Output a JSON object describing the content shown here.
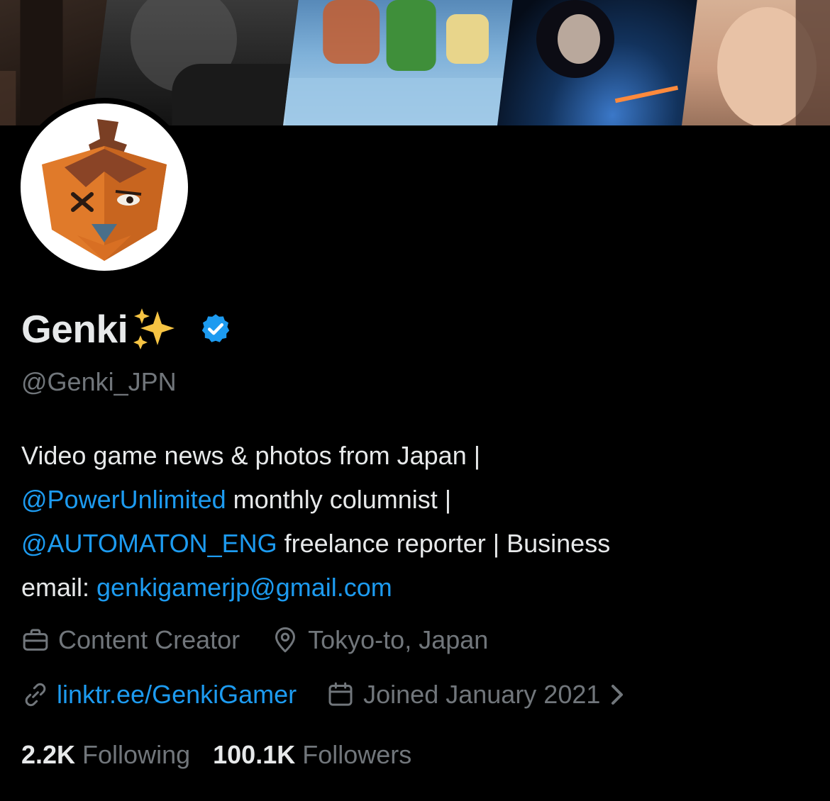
{
  "profile": {
    "display_name": "Genki",
    "name_emoji": "sparkles-emoji",
    "verified_badge": "verified-badge-icon",
    "handle": "@Genki_JPN"
  },
  "bio": {
    "line1": "Video game news & photos from Japan |",
    "mention_power": "@PowerUnlimited",
    "line2_rest": " monthly columnist |",
    "mention_automaton": "@AUTOMATON_ENG",
    "line3_rest": " freelance reporter | Business",
    "email_prefix": "email: ",
    "email_link": "genkigamerjp@gmail.com"
  },
  "meta": {
    "category": "Content Creator",
    "category_icon": "briefcase-icon",
    "location": "Tokyo-to, Japan",
    "location_icon": "location-pin-icon",
    "website": "linktr.ee/GenkiGamer",
    "website_icon": "link-icon",
    "joined": "Joined January 2021",
    "joined_icon": "calendar-icon",
    "joined_chevron": "chevron-right-icon"
  },
  "stats": {
    "following_count": "2.2K",
    "following_label": "Following",
    "followers_count": "100.1K",
    "followers_label": "Followers"
  },
  "colors": {
    "background": "#000000",
    "primary_text": "#e7e9ea",
    "secondary_text": "#71767b",
    "link": "#1d9bf0",
    "verified": "#1d9bf0"
  }
}
